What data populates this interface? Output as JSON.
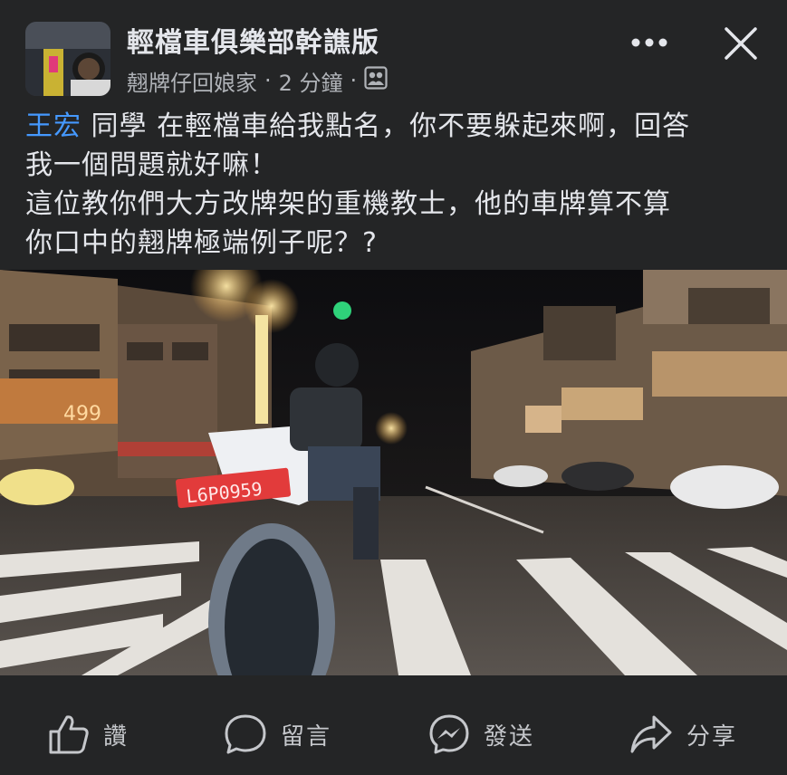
{
  "header": {
    "title": "輕檔車俱樂部幹譙版",
    "author": "翹牌仔回娘家",
    "separator": "·",
    "time": "2 分鐘",
    "privacy_icon": "group-icon",
    "more_icon": "more-horizontal-icon",
    "close_icon": "close-icon"
  },
  "post": {
    "mention": "王宏",
    "text_line1_rest": " 同學 在輕檔車給我點名，你不要躲起來啊，回答",
    "text_line2": "我一個問題就好嘛！",
    "text_line3": "這位教你們大方改牌架的重機教士，他的車牌算不算",
    "text_line4": "你口中的翹牌極端例子呢？?"
  },
  "media": {
    "plate_text": "L6P0959",
    "store_sign_text": "499"
  },
  "actions": [
    {
      "label": "讚",
      "icon": "like-icon"
    },
    {
      "label": "留言",
      "icon": "comment-icon"
    },
    {
      "label": "發送",
      "icon": "messenger-icon"
    },
    {
      "label": "分享",
      "icon": "share-icon"
    }
  ]
}
